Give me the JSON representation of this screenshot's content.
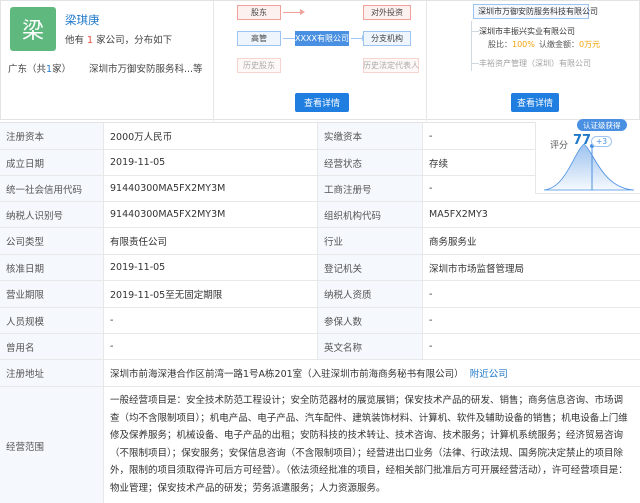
{
  "person": {
    "avatar_char": "梁",
    "name": "梁琪庚",
    "sub_prefix": "他有",
    "company_count": "1",
    "sub_mid": "家公司，分布如下",
    "region_label": "广东（共",
    "region_count": "1",
    "region_suffix": "家）",
    "company_short": "深圳市万御安防服务科...等"
  },
  "diagram_left": {
    "shareholder": "股东",
    "executive": "高管",
    "history": "历史股东",
    "center": "XXXX有限公司",
    "investment": "对外投资",
    "branch": "分支机构",
    "history_legal": "历史法定代表人",
    "button": "查看详情"
  },
  "diagram_right": {
    "company": "深圳市万御安防服务科技有限公司",
    "sub_company": "深圳市丰振兴实业有限公司",
    "shareholder_label": "股比：",
    "shareholder_value": "100%",
    "capital_label": "认缴金额：",
    "capital_value": "0万元",
    "history": "丰裕资产管理（深圳）有限公司",
    "button": "查看详情"
  },
  "score": {
    "badge": "认证级获得",
    "label": "评分",
    "value": "77",
    "delta": "+3"
  },
  "table": {
    "rows": [
      {
        "l1": "注册资本",
        "v1": "2000万人民币",
        "l2": "实缴资本",
        "v2": "-"
      },
      {
        "l1": "成立日期",
        "v1": "2019-11-05",
        "l2": "经营状态",
        "v2": "存续"
      },
      {
        "l1": "统一社会信用代码",
        "v1": "91440300MA5FX2MY3M",
        "l2": "工商注册号",
        "v2": "-"
      },
      {
        "l1": "纳税人识别号",
        "v1": "91440300MA5FX2MY3M",
        "l2": "组织机构代码",
        "v2": "MA5FX2MY3"
      },
      {
        "l1": "公司类型",
        "v1": "有限责任公司",
        "l2": "行业",
        "v2": "商务服务业"
      },
      {
        "l1": "核准日期",
        "v1": "2019-11-05",
        "l2": "登记机关",
        "v2": "深圳市市场监督管理局"
      },
      {
        "l1": "营业期限",
        "v1": "2019-11-05至无固定期限",
        "l2": "纳税人资质",
        "v2": "-"
      },
      {
        "l1": "人员规模",
        "v1": "-",
        "l2": "参保人数",
        "v2": "-"
      },
      {
        "l1": "曾用名",
        "v1": "-",
        "l2": "英文名称",
        "v2": "-"
      }
    ],
    "address_label": "注册地址",
    "address_value": "深圳市前海深港合作区前湾一路1号A栋201室（入驻深圳市前海商务秘书有限公司）",
    "address_link": "附近公司",
    "scope_label": "经营范围",
    "scope_value": "一般经营项目是：安全技术防范工程设计；安全防范器材的展览展销；保安技术产品的研发、销售；商务信息咨询、市场调查（均不含限制项目）；机电产品、电子产品、汽车配件、建筑装饰材料、计算机、软件及辅助设备的销售；机电设备上门维修及保养服务；机械设备、电子产品的出租；安防科技的技术转让、技术咨询、技术服务；计算机系统服务；经济贸易咨询（不限制项目）；保安服务；安保信息咨询（不含限制项目）；经营进出口业务（法律、行政法规、国务院决定禁止的项目除外，限制的项目须取得许可后方可经营）。（依法须经批准的项目，经相关部门批准后方可开展经营活动），许可经营项目是：物业管理；保安技术产品的研发；劳务派遣服务；人力资源服务。"
  },
  "colors": {
    "accent_blue": "#1f7ee0",
    "link_blue": "#1f78c8",
    "avatar_green": "#5fb97e",
    "label_bg": "#f5f8fc"
  }
}
